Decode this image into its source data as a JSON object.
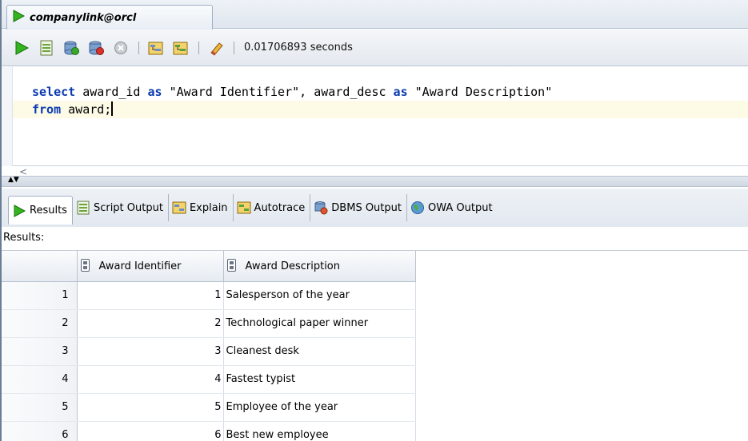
{
  "editor_tab": {
    "label": "companylink@orcl"
  },
  "toolbar": {
    "timing": "0.01706893 seconds"
  },
  "editor": {
    "line1": {
      "kw1": "select",
      "t1": " award_id ",
      "kw2": "as",
      "t2": " \"Award Identifier\", award_desc ",
      "kw3": "as",
      "t3": " \"Award Description\""
    },
    "line2": {
      "kw1": "from",
      "t1": " award;"
    },
    "scroll_left_arrow": "<"
  },
  "result_tabs": [
    {
      "label": "Results"
    },
    {
      "label": "Script Output"
    },
    {
      "label": "Explain"
    },
    {
      "label": "Autotrace"
    },
    {
      "label": "DBMS Output"
    },
    {
      "label": "OWA Output"
    }
  ],
  "results_label": "Results:",
  "grid": {
    "columns": [
      "Award Identifier",
      "Award Description"
    ],
    "rows": [
      {
        "n": "1",
        "id": "1",
        "desc": "Salesperson of the year"
      },
      {
        "n": "2",
        "id": "2",
        "desc": "Technological paper winner"
      },
      {
        "n": "3",
        "id": "3",
        "desc": "Cleanest desk"
      },
      {
        "n": "4",
        "id": "4",
        "desc": "Fastest typist"
      },
      {
        "n": "5",
        "id": "5",
        "desc": "Employee of the year"
      },
      {
        "n": "6",
        "id": "6",
        "desc": "Best new employee"
      }
    ]
  },
  "colors": {
    "keyword": "#0b3bb0",
    "current_line": "#fdfbe6",
    "run_green": "#2fa21f"
  }
}
